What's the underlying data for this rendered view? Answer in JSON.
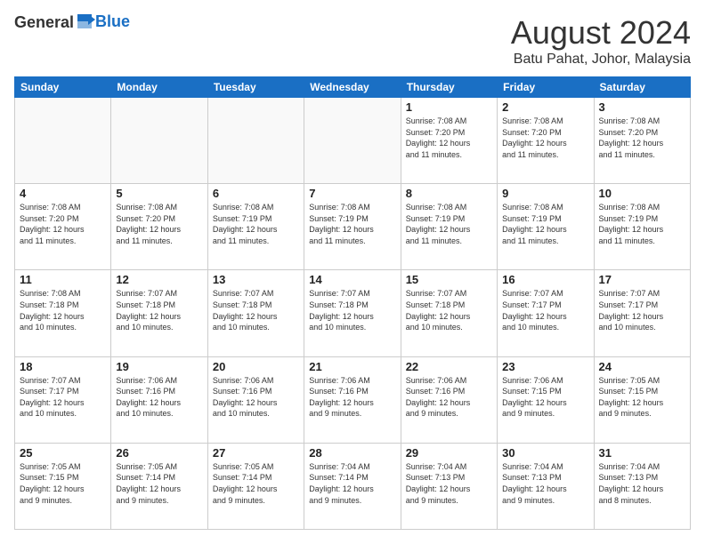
{
  "header": {
    "logo_line1": "General",
    "logo_line2": "Blue",
    "month_title": "August 2024",
    "location": "Batu Pahat, Johor, Malaysia"
  },
  "weekdays": [
    "Sunday",
    "Monday",
    "Tuesday",
    "Wednesday",
    "Thursday",
    "Friday",
    "Saturday"
  ],
  "weeks": [
    [
      {
        "day": "",
        "info": ""
      },
      {
        "day": "",
        "info": ""
      },
      {
        "day": "",
        "info": ""
      },
      {
        "day": "",
        "info": ""
      },
      {
        "day": "1",
        "info": "Sunrise: 7:08 AM\nSunset: 7:20 PM\nDaylight: 12 hours\nand 11 minutes."
      },
      {
        "day": "2",
        "info": "Sunrise: 7:08 AM\nSunset: 7:20 PM\nDaylight: 12 hours\nand 11 minutes."
      },
      {
        "day": "3",
        "info": "Sunrise: 7:08 AM\nSunset: 7:20 PM\nDaylight: 12 hours\nand 11 minutes."
      }
    ],
    [
      {
        "day": "4",
        "info": "Sunrise: 7:08 AM\nSunset: 7:20 PM\nDaylight: 12 hours\nand 11 minutes."
      },
      {
        "day": "5",
        "info": "Sunrise: 7:08 AM\nSunset: 7:20 PM\nDaylight: 12 hours\nand 11 minutes."
      },
      {
        "day": "6",
        "info": "Sunrise: 7:08 AM\nSunset: 7:19 PM\nDaylight: 12 hours\nand 11 minutes."
      },
      {
        "day": "7",
        "info": "Sunrise: 7:08 AM\nSunset: 7:19 PM\nDaylight: 12 hours\nand 11 minutes."
      },
      {
        "day": "8",
        "info": "Sunrise: 7:08 AM\nSunset: 7:19 PM\nDaylight: 12 hours\nand 11 minutes."
      },
      {
        "day": "9",
        "info": "Sunrise: 7:08 AM\nSunset: 7:19 PM\nDaylight: 12 hours\nand 11 minutes."
      },
      {
        "day": "10",
        "info": "Sunrise: 7:08 AM\nSunset: 7:19 PM\nDaylight: 12 hours\nand 11 minutes."
      }
    ],
    [
      {
        "day": "11",
        "info": "Sunrise: 7:08 AM\nSunset: 7:18 PM\nDaylight: 12 hours\nand 10 minutes."
      },
      {
        "day": "12",
        "info": "Sunrise: 7:07 AM\nSunset: 7:18 PM\nDaylight: 12 hours\nand 10 minutes."
      },
      {
        "day": "13",
        "info": "Sunrise: 7:07 AM\nSunset: 7:18 PM\nDaylight: 12 hours\nand 10 minutes."
      },
      {
        "day": "14",
        "info": "Sunrise: 7:07 AM\nSunset: 7:18 PM\nDaylight: 12 hours\nand 10 minutes."
      },
      {
        "day": "15",
        "info": "Sunrise: 7:07 AM\nSunset: 7:18 PM\nDaylight: 12 hours\nand 10 minutes."
      },
      {
        "day": "16",
        "info": "Sunrise: 7:07 AM\nSunset: 7:17 PM\nDaylight: 12 hours\nand 10 minutes."
      },
      {
        "day": "17",
        "info": "Sunrise: 7:07 AM\nSunset: 7:17 PM\nDaylight: 12 hours\nand 10 minutes."
      }
    ],
    [
      {
        "day": "18",
        "info": "Sunrise: 7:07 AM\nSunset: 7:17 PM\nDaylight: 12 hours\nand 10 minutes."
      },
      {
        "day": "19",
        "info": "Sunrise: 7:06 AM\nSunset: 7:16 PM\nDaylight: 12 hours\nand 10 minutes."
      },
      {
        "day": "20",
        "info": "Sunrise: 7:06 AM\nSunset: 7:16 PM\nDaylight: 12 hours\nand 10 minutes."
      },
      {
        "day": "21",
        "info": "Sunrise: 7:06 AM\nSunset: 7:16 PM\nDaylight: 12 hours\nand 9 minutes."
      },
      {
        "day": "22",
        "info": "Sunrise: 7:06 AM\nSunset: 7:16 PM\nDaylight: 12 hours\nand 9 minutes."
      },
      {
        "day": "23",
        "info": "Sunrise: 7:06 AM\nSunset: 7:15 PM\nDaylight: 12 hours\nand 9 minutes."
      },
      {
        "day": "24",
        "info": "Sunrise: 7:05 AM\nSunset: 7:15 PM\nDaylight: 12 hours\nand 9 minutes."
      }
    ],
    [
      {
        "day": "25",
        "info": "Sunrise: 7:05 AM\nSunset: 7:15 PM\nDaylight: 12 hours\nand 9 minutes."
      },
      {
        "day": "26",
        "info": "Sunrise: 7:05 AM\nSunset: 7:14 PM\nDaylight: 12 hours\nand 9 minutes."
      },
      {
        "day": "27",
        "info": "Sunrise: 7:05 AM\nSunset: 7:14 PM\nDaylight: 12 hours\nand 9 minutes."
      },
      {
        "day": "28",
        "info": "Sunrise: 7:04 AM\nSunset: 7:14 PM\nDaylight: 12 hours\nand 9 minutes."
      },
      {
        "day": "29",
        "info": "Sunrise: 7:04 AM\nSunset: 7:13 PM\nDaylight: 12 hours\nand 9 minutes."
      },
      {
        "day": "30",
        "info": "Sunrise: 7:04 AM\nSunset: 7:13 PM\nDaylight: 12 hours\nand 9 minutes."
      },
      {
        "day": "31",
        "info": "Sunrise: 7:04 AM\nSunset: 7:13 PM\nDaylight: 12 hours\nand 8 minutes."
      }
    ]
  ]
}
